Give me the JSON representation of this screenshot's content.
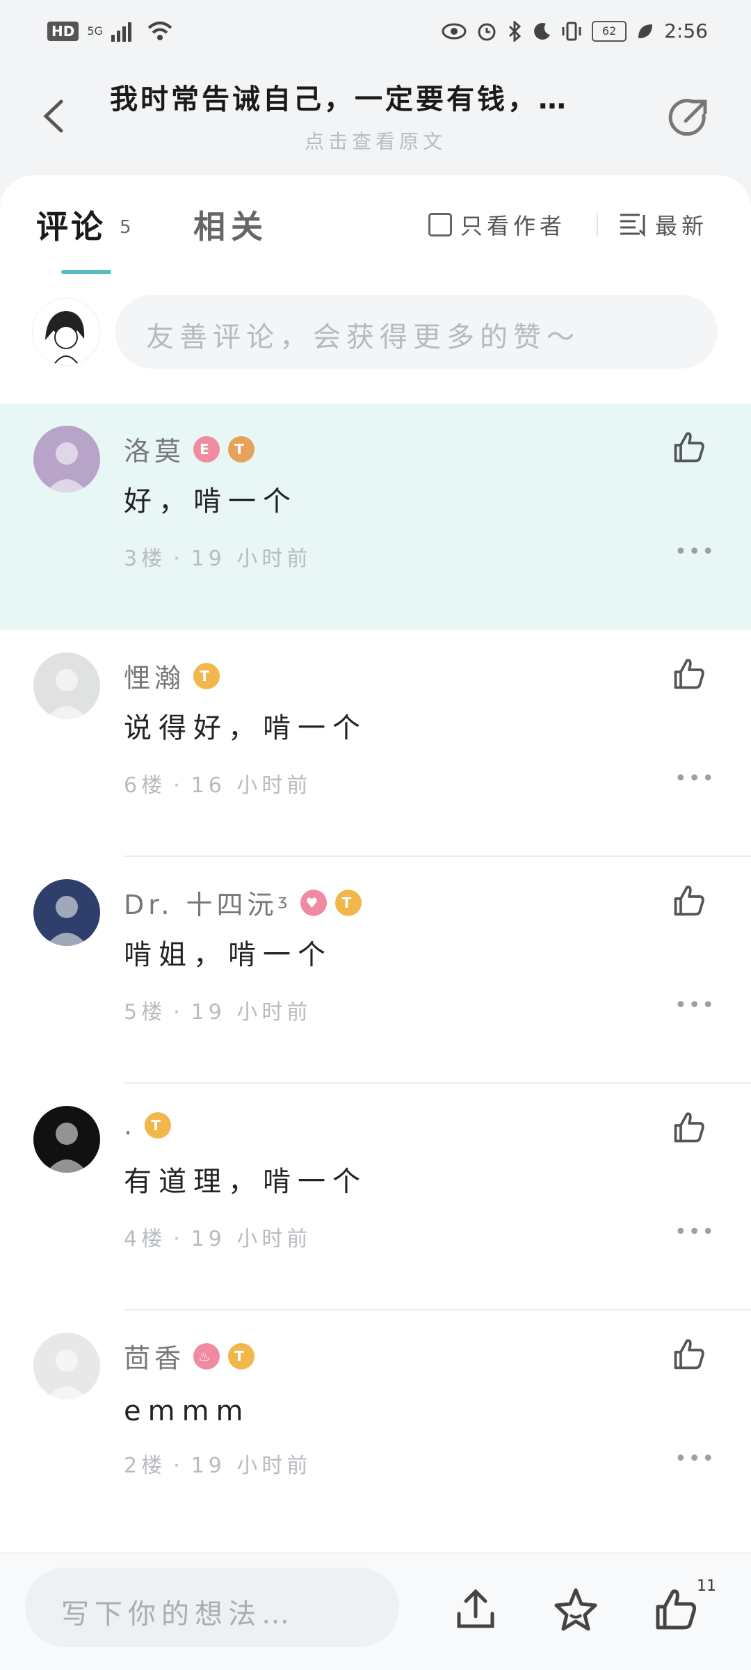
{
  "status_bar": {
    "network_label": "HD",
    "signal_label": "5G",
    "battery": "62",
    "time": "2:56"
  },
  "header": {
    "title": "我时常告诫自己，一定要有钱，…",
    "subtitle": "点击查看原文"
  },
  "tabs": {
    "comments_label": "评论",
    "comments_count": "5",
    "related_label": "相关",
    "author_only_label": "只看作者",
    "sort_label": "最新"
  },
  "comment_input": {
    "placeholder": "友善评论，会获得更多的赞～"
  },
  "comments": [
    {
      "user": "洛莫",
      "text": "好，啃一个",
      "floor": "3楼",
      "time": "19 小时前",
      "avatar_color": "#b9a4c9",
      "highlight": true
    },
    {
      "user": "悝瀚",
      "text": "说得好，啃一个",
      "floor": "6楼",
      "time": "16 小时前",
      "avatar_color": "#dfe2e0"
    },
    {
      "user": "Dr. 十四沅ᶾ",
      "text": "啃姐，啃一个",
      "floor": "5楼",
      "time": "19 小时前",
      "avatar_color": "#2f3f6b"
    },
    {
      "user": ".",
      "text": "有道理，啃一个",
      "floor": "4楼",
      "time": "19 小时前",
      "avatar_color": "#111111"
    },
    {
      "user": "茴香",
      "text": "emmm",
      "floor": "2楼",
      "time": "19 小时前",
      "avatar_color": "#e8e8e8"
    }
  ],
  "meta_separator": "·",
  "bottom_bar": {
    "placeholder": "写下你的想法…",
    "like_count": "11"
  },
  "colors": {
    "accent": "#5bbdc2",
    "highlight_bg": "#e9f6f6"
  }
}
